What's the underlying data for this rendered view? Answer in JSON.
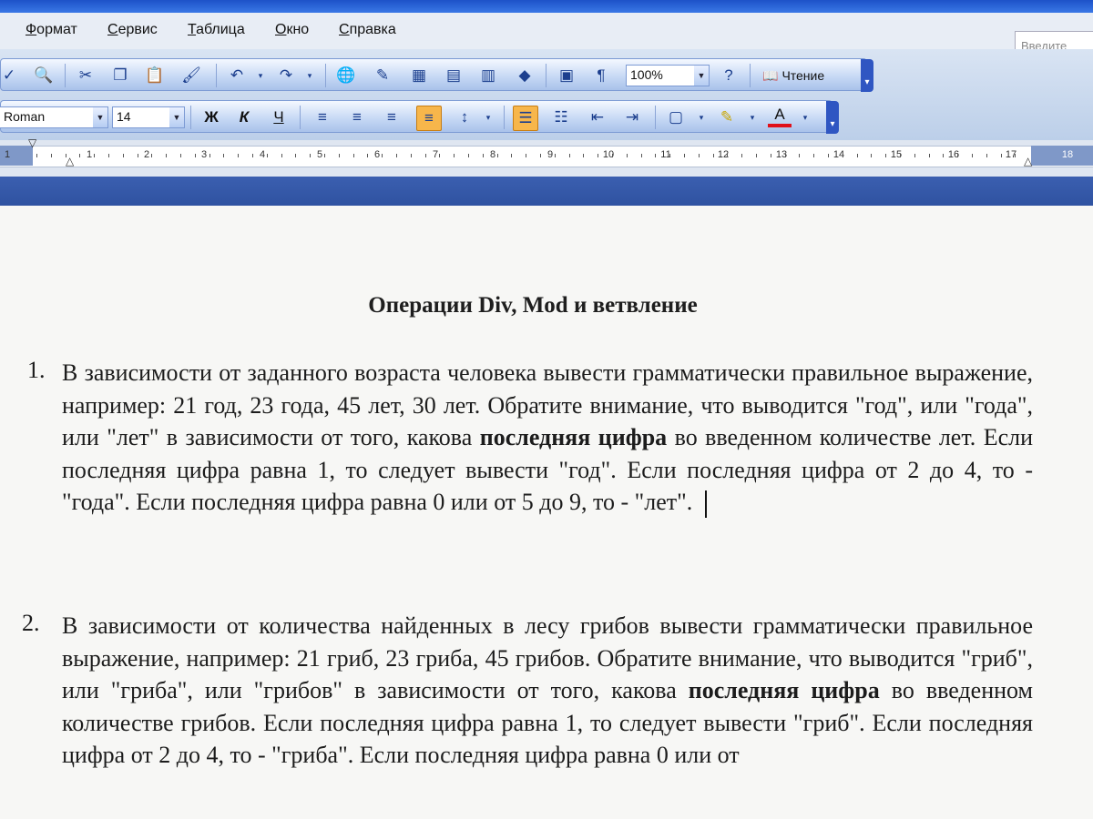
{
  "menu": {
    "items": [
      "Формат",
      "Сервис",
      "Таблица",
      "Окно",
      "Справка"
    ],
    "help_box": "Введите"
  },
  "toolbar": {
    "zoom_value": "100%",
    "reading_label": "Чтение",
    "font_name": "Roman",
    "font_size": "14",
    "bold_label": "Ж",
    "italic_label": "К",
    "underline_label": "Ч",
    "font_color_label": "A",
    "paragraph_mark": "¶"
  },
  "ruler": {
    "numbers": [
      "1",
      "1",
      "2",
      "3",
      "4",
      "5",
      "6",
      "7",
      "8",
      "9",
      "10",
      "11",
      "12",
      "13",
      "14",
      "15",
      "16",
      "17",
      "18"
    ]
  },
  "document": {
    "title": "Операции Div, Mod и ветвление",
    "items": [
      {
        "number": "1.",
        "before_bold": "В зависимости от заданного возраста человека вывести грамматически правильное выражение, например: 21 год, 23 года, 45 лет, 30 лет. Обратите внимание, что выводится \"год\", или \"года\", или \"лет\" в зависимости от того, какова ",
        "bold": "последняя цифра",
        "after_bold": " во введенном количестве лет. Если последняя цифра равна 1, то следует вывести \"год\". Если последняя цифра от 2 до 4, то - \"года\". Если последняя цифра равна 0 или от 5 до 9, то - \"лет\"."
      },
      {
        "number": "2.",
        "before_bold": "В зависимости от количества найденных в лесу грибов вывести грамматически правильное выражение, например: 21 гриб, 23 гриба, 45 грибов. Обратите внимание, что выводится \"гриб\", или \"гриба\", или \"грибов\" в зависимости от того, какова ",
        "bold": "последняя цифра",
        "after_bold": " во введенном количестве грибов. Если последняя цифра равна 1, то следует вывести \"гриб\". Если последняя цифра от 2 до 4, то - \"гриба\". Если последняя цифра равна 0 или от"
      }
    ]
  }
}
